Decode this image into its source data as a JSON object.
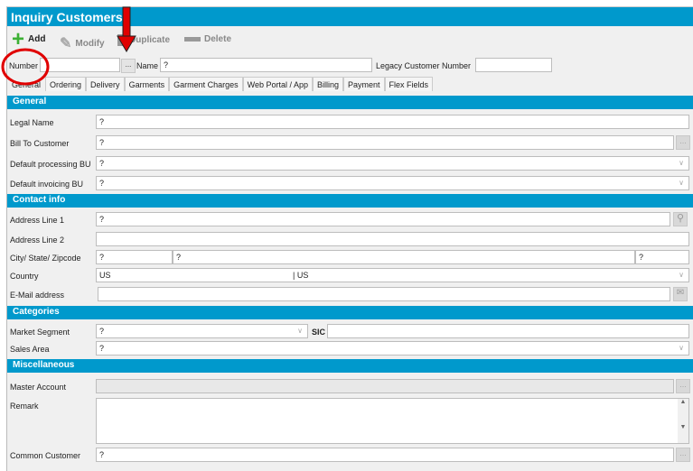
{
  "window": {
    "title": "Inquiry Customers"
  },
  "toolbar": {
    "add": "Add",
    "modify": "Modify",
    "duplicate": "Duplicate",
    "delete": "Delete"
  },
  "header": {
    "number_label": "Number",
    "number_value": "",
    "browse_label": "...",
    "name_label": "Name",
    "name_value": "?",
    "legacy_label": "Legacy Customer Number",
    "legacy_value": ""
  },
  "tabs": [
    "General",
    "Ordering",
    "Delivery",
    "Garments",
    "Garment Charges",
    "Web Portal / App",
    "Billing",
    "Payment",
    "Flex Fields"
  ],
  "general": {
    "title": "General",
    "legal_name_label": "Legal Name",
    "legal_name": "?",
    "bill_to_label": "Bill To Customer",
    "bill_to": "?",
    "proc_bu_label": "Default processing BU",
    "proc_bu": "?",
    "inv_bu_label": "Default invoicing BU",
    "inv_bu": "?"
  },
  "contact": {
    "title": "Contact info",
    "addr1_label": "Address Line 1",
    "addr1": "?",
    "addr2_label": "Address Line 2",
    "addr2": "",
    "city_label": "City/ State/ Zipcode",
    "city": "?",
    "state": "?",
    "zip": "?",
    "country_label": "Country",
    "country_code": "US",
    "country_name": "| US",
    "email_label": "E-Mail address",
    "email": ""
  },
  "categories": {
    "title": "Categories",
    "market_label": "Market Segment",
    "market": "?",
    "sic_label": "SIC",
    "sic": "",
    "sales_label": "Sales Area",
    "sales": "?"
  },
  "misc": {
    "title": "Miscellaneous",
    "master_label": "Master Account",
    "master": "",
    "remark_label": "Remark",
    "remark": "",
    "common_label": "Common Customer",
    "common": "?"
  },
  "colors": {
    "accent": "#0099cc",
    "annotation": "#e00000"
  }
}
